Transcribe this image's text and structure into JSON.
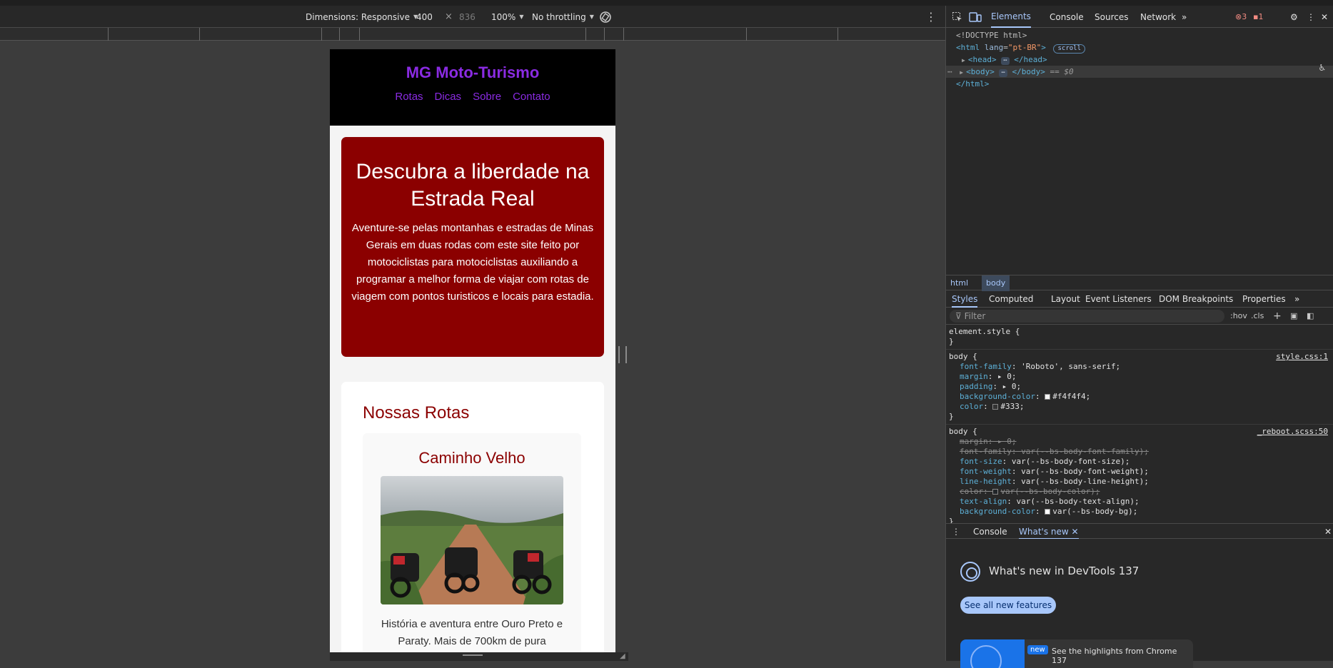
{
  "device_toolbar": {
    "dimensions_label": "Dimensions: Responsive",
    "width": "400",
    "times": "×",
    "height": "836",
    "zoom": "100%",
    "throttling": "No throttling"
  },
  "site": {
    "title": "MG Moto-Turismo",
    "nav": [
      "Rotas",
      "Dicas",
      "Sobre",
      "Contato"
    ],
    "hero_title": "Descubra a liberdade na Estrada Real",
    "hero_text": "Aventure-se pelas montanhas e estradas de Minas Gerais em duas rodas com este site feito por motociclistas para motociclistas auxiliando a programar a melhor forma de viajar com rotas de viagem com pontos turisticos e locais para estadia.",
    "routes_title": "Nossas Rotas",
    "route_card": {
      "title": "Caminho Velho",
      "description": "História e aventura entre Ouro Preto e Paraty. Mais de 700km de pura"
    }
  },
  "devtools": {
    "tabs": [
      "Elements",
      "Console",
      "Sources",
      "Network"
    ],
    "active_tab": "Elements",
    "errors": "3",
    "warnings": "1",
    "dom": {
      "doctype": "<!DOCTYPE html>",
      "html_open_tag": "html",
      "html_lang_attr": "lang",
      "html_lang_value": "\"pt-BR\"",
      "scroll_badge": "scroll",
      "head": "head",
      "body": "body",
      "selected_marker": "== $0",
      "html_close": "</html>"
    },
    "breadcrumb": [
      "html",
      "body"
    ],
    "styles_tabs": [
      "Styles",
      "Computed",
      "Layout",
      "Event Listeners",
      "DOM Breakpoints",
      "Properties"
    ],
    "filter_placeholder": "Filter",
    "hov": ":hov",
    "cls": ".cls",
    "rules": [
      {
        "selector": "element.style {",
        "source": "",
        "props": []
      },
      {
        "selector": "body {",
        "source": "style.css:1",
        "props": [
          {
            "name": "font-family",
            "value": "'Roboto', sans-serif;",
            "struck": false
          },
          {
            "name": "margin",
            "value": "▸ 0;",
            "struck": false
          },
          {
            "name": "padding",
            "value": "▸ 0;",
            "struck": false
          },
          {
            "name": "background-color",
            "value": "#f4f4f4;",
            "struck": false,
            "swatch": "#f4f4f4"
          },
          {
            "name": "color",
            "value": "#333;",
            "struck": false,
            "swatch": "#333333"
          }
        ]
      },
      {
        "selector": "body {",
        "source": "_reboot.scss:50",
        "props": [
          {
            "name": "margin",
            "value": "▸ 0;",
            "struck": true
          },
          {
            "name": "font-family",
            "value": "var(--bs-body-font-family);",
            "struck": true
          },
          {
            "name": "font-size",
            "value": "var(--bs-body-font-size);",
            "struck": false
          },
          {
            "name": "font-weight",
            "value": "var(--bs-body-font-weight);",
            "struck": false
          },
          {
            "name": "line-height",
            "value": "var(--bs-body-line-height);",
            "struck": false
          },
          {
            "name": "color",
            "value": "var(--bs-body-color);",
            "struck": true,
            "swatch": "#212529"
          },
          {
            "name": "text-align",
            "value": "var(--bs-body-text-align);",
            "struck": false
          },
          {
            "name": "background-color",
            "value": "var(--bs-body-bg);",
            "struck": false,
            "swatch": "#ffffff"
          }
        ]
      }
    ],
    "drawer_tabs": [
      "Console",
      "What's new"
    ],
    "whats_new": {
      "title": "What's new in DevTools 137",
      "button": "See all new features",
      "badge": "new",
      "highlight": "See the highlights from Chrome 137"
    }
  }
}
